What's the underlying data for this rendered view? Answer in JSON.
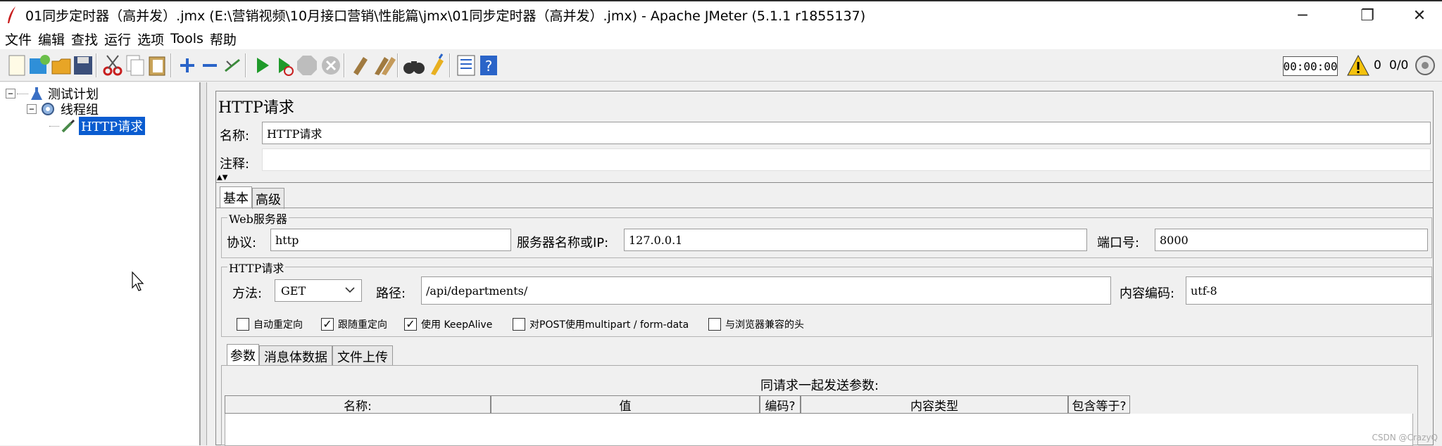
{
  "window": {
    "title": "01同步定时器（高并发）.jmx (E:\\营销视频\\10月接口营销\\性能篇\\jmx\\01同步定时器（高并发）.jmx) - Apache JMeter (5.1.1 r1855137)",
    "minimize": "─",
    "maximize": "❐",
    "close": "✕"
  },
  "menu": [
    "文件",
    "编辑",
    "查找",
    "运行",
    "选项",
    "Tools",
    "帮助"
  ],
  "toolbar": {
    "timer": "00:00:00",
    "warning_count": "0",
    "thread_count": "0/0"
  },
  "tree": {
    "root": "测试计划",
    "thread_group": "线程组",
    "http_request": "HTTP请求",
    "expander_minus": "−"
  },
  "panel": {
    "title": "HTTP请求",
    "name_label": "名称:",
    "name_value": "HTTP请求",
    "comment_label": "注释:",
    "comment_value": "",
    "collapse_marker": "▲▼"
  },
  "tabs": [
    "基本",
    "高级"
  ],
  "web_server": {
    "group_title": "Web服务器",
    "protocol_label": "协议:",
    "protocol_value": "http",
    "server_label": "服务器名称或IP:",
    "server_value": "127.0.0.1",
    "port_label": "端口号:",
    "port_value": "8000"
  },
  "http_request": {
    "group_title": "HTTP请求",
    "method_label": "方法:",
    "method_value": "GET",
    "path_label": "路径:",
    "path_value": "/api/departments/",
    "encoding_label": "内容编码:",
    "encoding_value": "utf-8"
  },
  "checkboxes": [
    {
      "label": "自动重定向",
      "checked": false,
      "mark": ""
    },
    {
      "label": "跟随重定向",
      "checked": true,
      "mark": "✓"
    },
    {
      "label": "使用 KeepAlive",
      "checked": true,
      "mark": "✓"
    },
    {
      "label": "对POST使用multipart / form-data",
      "checked": false,
      "mark": ""
    },
    {
      "label": "与浏览器兼容的头",
      "checked": false,
      "mark": ""
    }
  ],
  "sub_tabs": [
    "参数",
    "消息体数据",
    "文件上传"
  ],
  "params": {
    "caption": "同请求一起发送参数:",
    "columns": [
      "名称:",
      "值",
      "编码?",
      "内容类型",
      "包含等于?"
    ]
  },
  "watermark": "CSDN @CrazyQ"
}
